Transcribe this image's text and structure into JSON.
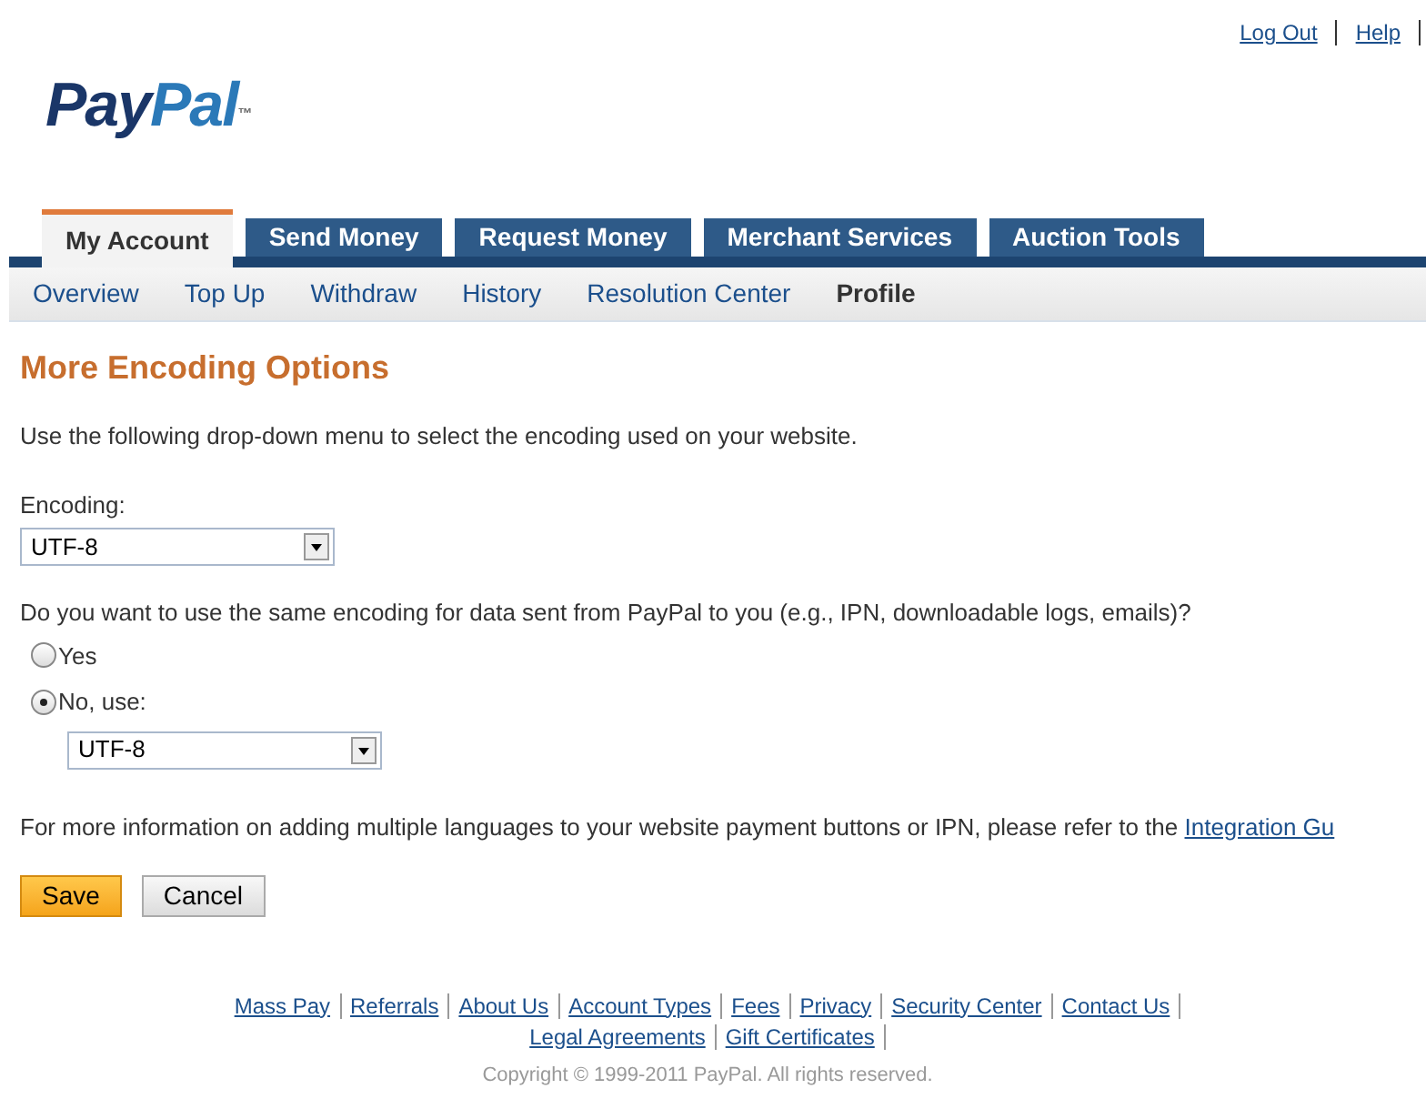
{
  "top_links": [
    "Log Out",
    "Help"
  ],
  "logo": {
    "pay": "Pay",
    "pal": "Pal",
    "mark": "™"
  },
  "tabs": [
    {
      "label": "My Account",
      "selected": true
    },
    {
      "label": "Send Money",
      "selected": false
    },
    {
      "label": "Request Money",
      "selected": false
    },
    {
      "label": "Merchant Services",
      "selected": false
    },
    {
      "label": "Auction Tools",
      "selected": false
    }
  ],
  "subnav": [
    {
      "label": "Overview",
      "selected": false
    },
    {
      "label": "Top Up",
      "selected": false
    },
    {
      "label": "Withdraw",
      "selected": false
    },
    {
      "label": "History",
      "selected": false
    },
    {
      "label": "Resolution Center",
      "selected": false
    },
    {
      "label": "Profile",
      "selected": true
    }
  ],
  "heading": "More Encoding Options",
  "intro": "Use the following drop-down menu to select the encoding used on your website.",
  "encoding": {
    "label": "Encoding:",
    "value": "UTF-8"
  },
  "question": "Do you want to use the same encoding for data sent from PayPal to you (e.g., IPN, downloadable logs, emails)?",
  "options": [
    {
      "label": "Yes",
      "selected": false
    },
    {
      "label": "No, use:",
      "selected": true
    }
  ],
  "no_encoding": {
    "value": "UTF-8"
  },
  "info": {
    "text": "For more information on adding multiple languages to your website payment buttons or IPN, please refer to the ",
    "link": "Integration Gu"
  },
  "buttons": [
    {
      "label": "Save",
      "kind": "primary"
    },
    {
      "label": "Cancel",
      "kind": "secondary"
    }
  ],
  "footer_rows": [
    [
      "Mass Pay",
      "Referrals",
      "About Us",
      "Account Types",
      "Fees",
      "Privacy",
      "Security Center",
      "Contact Us"
    ],
    [
      "Legal Agreements",
      "Gift Certificates"
    ]
  ],
  "copyright": "Copyright © 1999-2011 PayPal. All rights reserved."
}
